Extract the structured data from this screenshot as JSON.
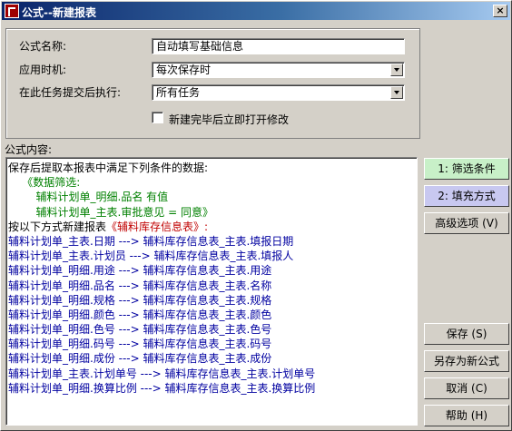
{
  "window": {
    "title": "公式--新建报表",
    "close_glyph": "×"
  },
  "form": {
    "name_label": "公式名称:",
    "name_value": "自动填写基础信息",
    "timing_label": "应用时机:",
    "timing_value": "每次保存时",
    "task_label": "在此任务提交后执行:",
    "task_value": "所有任务",
    "open_after_label": "新建完毕后立即打开修改",
    "open_after_checked": false
  },
  "content": {
    "label": "公式内容:",
    "lines": [
      {
        "text": "保存后提取本报表中满足下列条件的数据:",
        "color": "#000000"
      },
      {
        "text": "    《数据筛选:",
        "color": "#008000"
      },
      {
        "text": "        辅料计划单_明细.品名 有值",
        "color": "#008000"
      },
      {
        "text": "        辅料计划单_主表.审批意见 = 同意》",
        "color": "#008000"
      },
      {
        "text": "按以下方式新建报表",
        "color": "#000000",
        "suffix": "《辅料库存信息表》:",
        "suffix_color": "#c00000"
      },
      {
        "text": "辅料计划单_主表.日期 ---> 辅料库存信息表_主表.填报日期",
        "color": "#0000a0"
      },
      {
        "text": "辅料计划单_主表.计划员 ---> 辅料库存信息表_主表.填报人",
        "color": "#0000a0"
      },
      {
        "text": "辅料计划单_明细.用途 ---> 辅料库存信息表_主表.用途",
        "color": "#0000a0"
      },
      {
        "text": "辅料计划单_明细.品名 ---> 辅料库存信息表_主表.名称",
        "color": "#0000a0"
      },
      {
        "text": "辅料计划单_明细.规格 ---> 辅料库存信息表_主表.规格",
        "color": "#0000a0"
      },
      {
        "text": "辅料计划单_明细.颜色 ---> 辅料库存信息表_主表.颜色",
        "color": "#0000a0"
      },
      {
        "text": "辅料计划单_明细.色号 ---> 辅料库存信息表_主表.色号",
        "color": "#0000a0"
      },
      {
        "text": "辅料计划单_明细.码号 ---> 辅料库存信息表_主表.码号",
        "color": "#0000a0"
      },
      {
        "text": "辅料计划单_明细.成份 ---> 辅料库存信息表_主表.成份",
        "color": "#0000a0"
      },
      {
        "text": "辅料计划单_主表.计划单号 ---> 辅料库存信息表_主表.计划单号",
        "color": "#0000a0"
      },
      {
        "text": "辅料计划单_明细.换算比例 ---> 辅料库存信息表_主表.换算比例",
        "color": "#0000a0"
      }
    ]
  },
  "buttons": {
    "filter": "1: 筛选条件",
    "fill": "2: 填充方式",
    "advanced": "高级选项 (V)",
    "save": "保存 (S)",
    "save_as": "另存为新公式",
    "cancel": "取消 (C)",
    "help": "帮助 (H)"
  }
}
